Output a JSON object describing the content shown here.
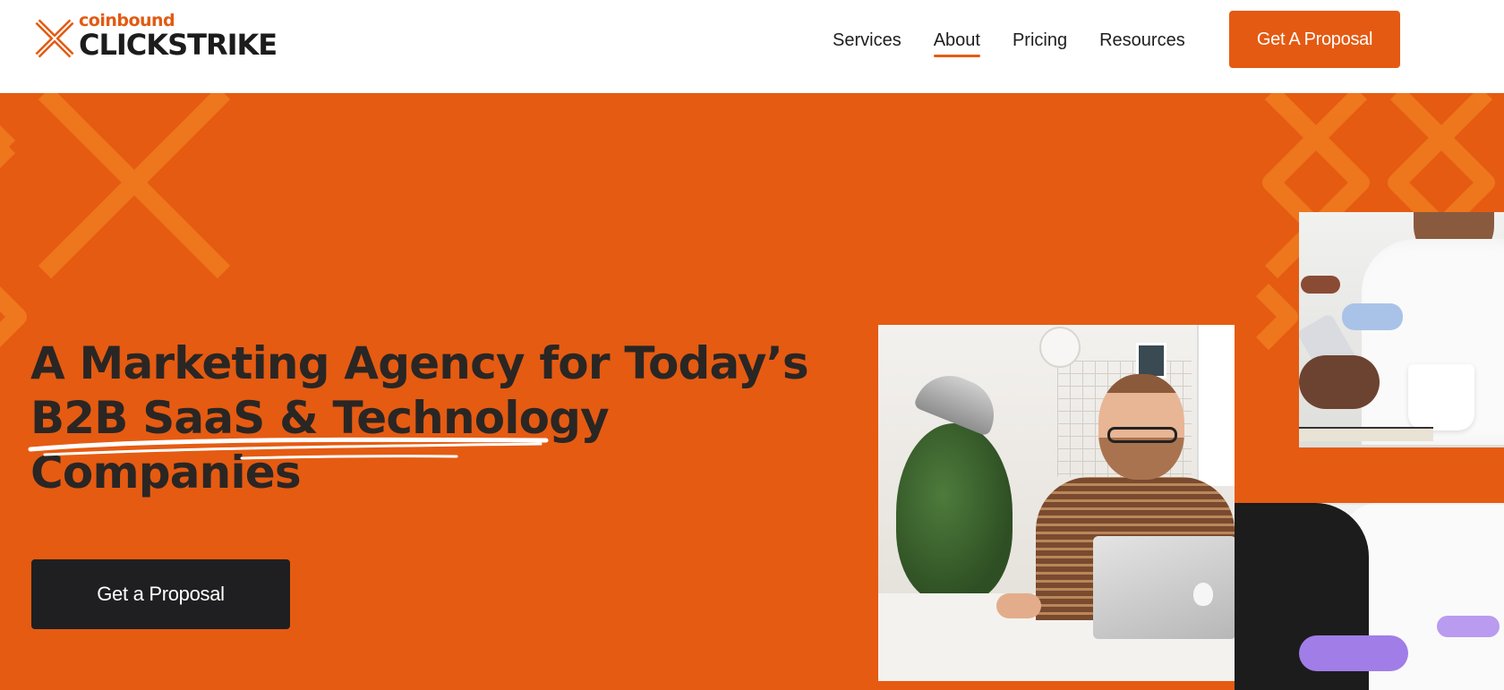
{
  "brand": {
    "small_text": "coinbound",
    "name": "CLICKSTRIKE",
    "accent_color": "#e55b12",
    "dark_color": "#1f1f21"
  },
  "nav": {
    "items": [
      {
        "label": "Services"
      },
      {
        "label": "About",
        "active": true
      },
      {
        "label": "Pricing"
      },
      {
        "label": "Resources"
      }
    ],
    "cta_label": "Get A Proposal"
  },
  "hero": {
    "headline_line1": "A Marketing Agency for Today’s",
    "headline_line2": "B2B SaaS & Technology",
    "headline_line3": "Companies",
    "cta_label": "Get a Proposal",
    "images": [
      {
        "icon": "man-at-desk-photo"
      },
      {
        "icon": "woman-with-phone-photo"
      },
      {
        "icon": "people-chat-bubbles-photo"
      }
    ]
  }
}
